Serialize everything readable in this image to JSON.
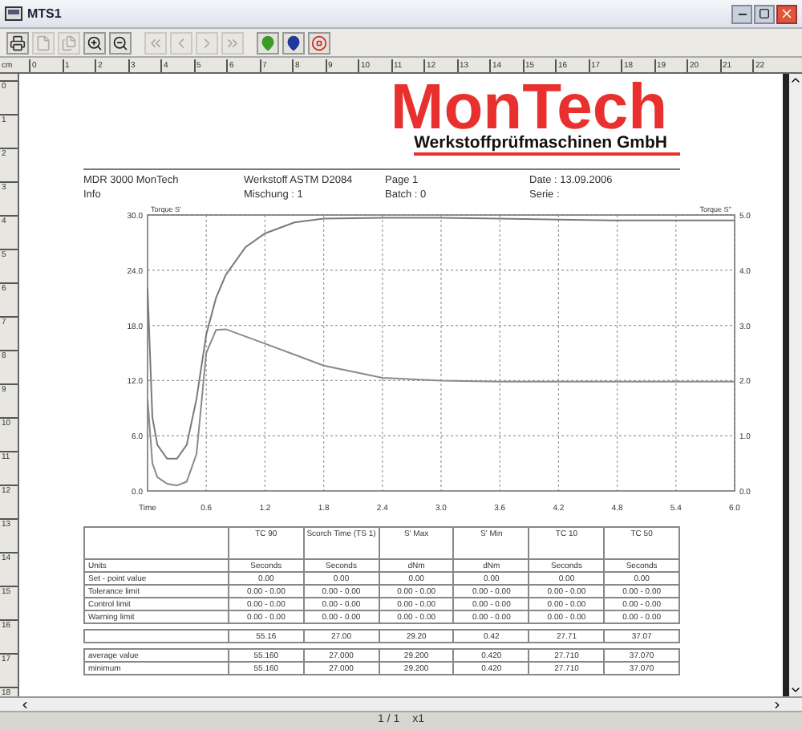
{
  "window": {
    "title": "MTS1"
  },
  "toolbar": [
    {
      "kind": "print",
      "disabled": false
    },
    {
      "kind": "page",
      "disabled": true
    },
    {
      "kind": "pages",
      "disabled": true
    },
    {
      "kind": "zoom-in",
      "disabled": false
    },
    {
      "kind": "zoom-out",
      "disabled": false
    },
    {
      "kind": "first",
      "disabled": true
    },
    {
      "kind": "prev",
      "disabled": true
    },
    {
      "kind": "next",
      "disabled": true
    },
    {
      "kind": "last",
      "disabled": true
    },
    {
      "kind": "pin-green",
      "disabled": false
    },
    {
      "kind": "pin-blue",
      "disabled": false
    },
    {
      "kind": "stop",
      "disabled": false
    }
  ],
  "ruler": {
    "unit": "cm",
    "h_marks": [
      "0",
      "1",
      "2",
      "3",
      "4",
      "5",
      "6",
      "7",
      "8",
      "9",
      "10",
      "11",
      "12",
      "13",
      "14",
      "15",
      "16",
      "17",
      "18",
      "19",
      "20",
      "21",
      "22"
    ],
    "v_marks": [
      "0",
      "1",
      "2",
      "3",
      "4",
      "5",
      "6",
      "7",
      "8",
      "9",
      "10",
      "11",
      "12",
      "13",
      "14",
      "15",
      "16",
      "17",
      "18"
    ]
  },
  "report": {
    "logo": {
      "name": "MonTech",
      "subtitle": "Werkstoffprüfmaschinen GmbH"
    },
    "header": [
      [
        "MDR 3000 MonTech",
        "Werkstoff ASTM D2084",
        "Page 1",
        "Date : 13.09.2006"
      ],
      [
        "Info",
        "Mischung : 1",
        "Batch : 0",
        "Serie :"
      ]
    ],
    "chart_data": {
      "type": "line",
      "xlabel": "Time",
      "ylabel": "Torque S'",
      "y2label": "Torque S''",
      "grid": true,
      "x": [
        0,
        0.05,
        0.1,
        0.2,
        0.3,
        0.4,
        0.5,
        0.6,
        0.7,
        0.8,
        1.0,
        1.2,
        1.5,
        1.8,
        2.4,
        3.0,
        3.6,
        4.2,
        4.8,
        5.4,
        6.0
      ],
      "series": [
        {
          "color": "#7a7a7a",
          "values": [
            22,
            8,
            5,
            3.5,
            3.5,
            5,
            10,
            17,
            21,
            23.5,
            26.5,
            28,
            29.2,
            29.6,
            29.7,
            29.7,
            29.6,
            29.5,
            29.4,
            29.4,
            29.4
          ]
        },
        {
          "axis": "y2",
          "color": "#8a8a8a",
          "values": [
            1.67,
            0.5,
            0.25,
            0.13,
            0.1,
            0.17,
            0.67,
            2.5,
            2.92,
            2.93,
            2.8,
            2.67,
            2.47,
            2.27,
            2.05,
            2.0,
            1.98,
            1.98,
            1.98,
            1.98,
            1.98
          ]
        }
      ],
      "xlim": [
        0,
        6
      ],
      "ylim": [
        0,
        30
      ],
      "y2lim": [
        0,
        5
      ],
      "xticks": [
        {
          "value": 0.6,
          "label": "0.6"
        },
        {
          "value": 1.2,
          "label": "1.2"
        },
        {
          "value": 1.8,
          "label": "1.8"
        },
        {
          "value": 2.4,
          "label": "2.4"
        },
        {
          "value": 3.0,
          "label": "3.0"
        },
        {
          "value": 3.6,
          "label": "3.6"
        },
        {
          "value": 4.2,
          "label": "4.2"
        },
        {
          "value": 4.8,
          "label": "4.8"
        },
        {
          "value": 5.4,
          "label": "5.4"
        },
        {
          "value": 6.0,
          "label": "6.0"
        }
      ],
      "yticks": [
        {
          "value": 0,
          "label": "0.0"
        },
        {
          "value": 6,
          "label": "6.0"
        },
        {
          "value": 12,
          "label": "12.0"
        },
        {
          "value": 18,
          "label": "18.0"
        },
        {
          "value": 24,
          "label": "24.0"
        },
        {
          "value": 30,
          "label": "30.0"
        }
      ],
      "y2ticks": [
        {
          "value": 0,
          "label": "0.0"
        },
        {
          "value": 1,
          "label": "1.0"
        },
        {
          "value": 2,
          "label": "2.0"
        },
        {
          "value": 3,
          "label": "3.0"
        },
        {
          "value": 4,
          "label": "4.0"
        },
        {
          "value": 5,
          "label": "5.0"
        }
      ]
    },
    "table": {
      "columns": [
        "TC 90",
        "Scorch Time (TS 1)",
        "S' Max",
        "S' Min",
        "TC 10",
        "TC 50"
      ],
      "limit_rows": [
        [
          "Units",
          "Seconds",
          "Seconds",
          "dNm",
          "dNm",
          "Seconds",
          "Seconds"
        ],
        [
          "Set - point value",
          "0.00",
          "0.00",
          "0.00",
          "0.00",
          "0.00",
          "0.00"
        ],
        [
          "Tolerance limit",
          "0.00 - 0.00",
          "0.00 - 0.00",
          "0.00 - 0.00",
          "0.00 - 0.00",
          "0.00 - 0.00",
          "0.00 - 0.00"
        ],
        [
          "Control limit",
          "0.00 - 0.00",
          "0.00 - 0.00",
          "0.00 - 0.00",
          "0.00 - 0.00",
          "0.00 - 0.00",
          "0.00 - 0.00"
        ],
        [
          "Warning limit",
          "0.00 - 0.00",
          "0.00 - 0.00",
          "0.00 - 0.00",
          "0.00 - 0.00",
          "0.00 - 0.00",
          "0.00 - 0.00"
        ]
      ],
      "result_row": [
        "55.16",
        "27.00",
        "29.20",
        "0.42",
        "27.71",
        "37.07"
      ],
      "stat_rows": [
        [
          "average value",
          "55.160",
          "27.000",
          "29.200",
          "0.420",
          "27.710",
          "37.070"
        ],
        [
          "minimum",
          "55.160",
          "27.000",
          "29.200",
          "0.420",
          "27.710",
          "37.070"
        ]
      ]
    }
  },
  "status_bar": {
    "page": "1 / 1",
    "zoom": "x1"
  }
}
